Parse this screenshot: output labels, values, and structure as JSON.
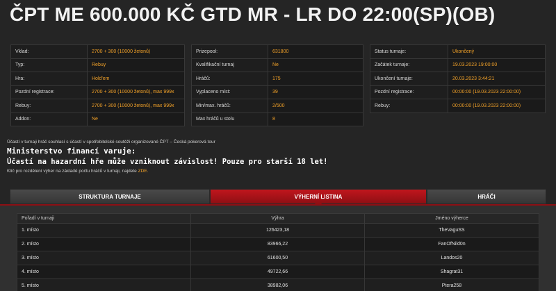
{
  "title": "ČPT ME 600.000 KČ GTD MR - LR DO 22:00(SP)(OB)",
  "info1": [
    {
      "label": "Vklad:",
      "value": "2700 + 300 (10000 žetonů)"
    },
    {
      "label": "Typ:",
      "value": "Rebuy"
    },
    {
      "label": "Hra:",
      "value": "Hold'em"
    },
    {
      "label": "Pozdní registrace:",
      "value": "2700 + 300 (10000 žetonů), max 999x"
    },
    {
      "label": "Rebuy:",
      "value": "2700 + 300 (10000 žetonů), max 999x"
    },
    {
      "label": "Addon:",
      "value": "Ne"
    }
  ],
  "info2": [
    {
      "label": "Prizepool:",
      "value": "631800"
    },
    {
      "label": "Kvalifikační turnaj",
      "value": "Ne"
    },
    {
      "label": "Hráčů:",
      "value": "175"
    },
    {
      "label": "Vyplaceno míst:",
      "value": "39"
    },
    {
      "label": "Min/max. hráčů:",
      "value": "2/500"
    },
    {
      "label": "Max hráčů u stolu",
      "value": "8"
    }
  ],
  "info3": [
    {
      "label": "Status turnaje:",
      "value": "Ukončený"
    },
    {
      "label": "Začátek turnaje:",
      "value": "19.03.2023 19:00:00"
    },
    {
      "label": "Ukončení turnaje:",
      "value": "20.03.2023 3:44:21"
    },
    {
      "label": "Pozdní registrace:",
      "value": "00:00:00 (19.03.2023 22:00:00)"
    },
    {
      "label": "Rebuy:",
      "value": "00:00:00 (19.03.2023 22:00:00)"
    }
  ],
  "notice1": "Účastí v turnaji hráč souhlasí s účastí v spotřebitelské soutěži organizované ČPT – Česká pokerová tour",
  "warning_title": "Ministerstvo financí varuje:",
  "warning_text": "Účastí na hazardní hře může vzniknout závislost! Pouze pro starší 18 let!",
  "notice2": "Klíč pro rozdělení výher na základě počtu hráčů v turnaji, najdete",
  "notice2_link": "ZDE.",
  "tabs": [
    "STRUKTURA TURNAJE",
    "VÝHERNÍ LISTINA",
    "HRÁČI"
  ],
  "results": {
    "headers": [
      "Pořadí v turnaji",
      "Výhra",
      "Jméno výherce"
    ],
    "rows": [
      {
        "place": "1. místo",
        "prize": "126423,18",
        "name": "TheVaguSS"
      },
      {
        "place": "2. místo",
        "prize": "83966,22",
        "name": "FanOfNild0n"
      },
      {
        "place": "3. místo",
        "prize": "61600,50",
        "name": "Landos20"
      },
      {
        "place": "4. místo",
        "prize": "49722,66",
        "name": "Shagrat31"
      },
      {
        "place": "5. místo",
        "prize": "38982,06",
        "name": "Ptera258"
      }
    ]
  }
}
